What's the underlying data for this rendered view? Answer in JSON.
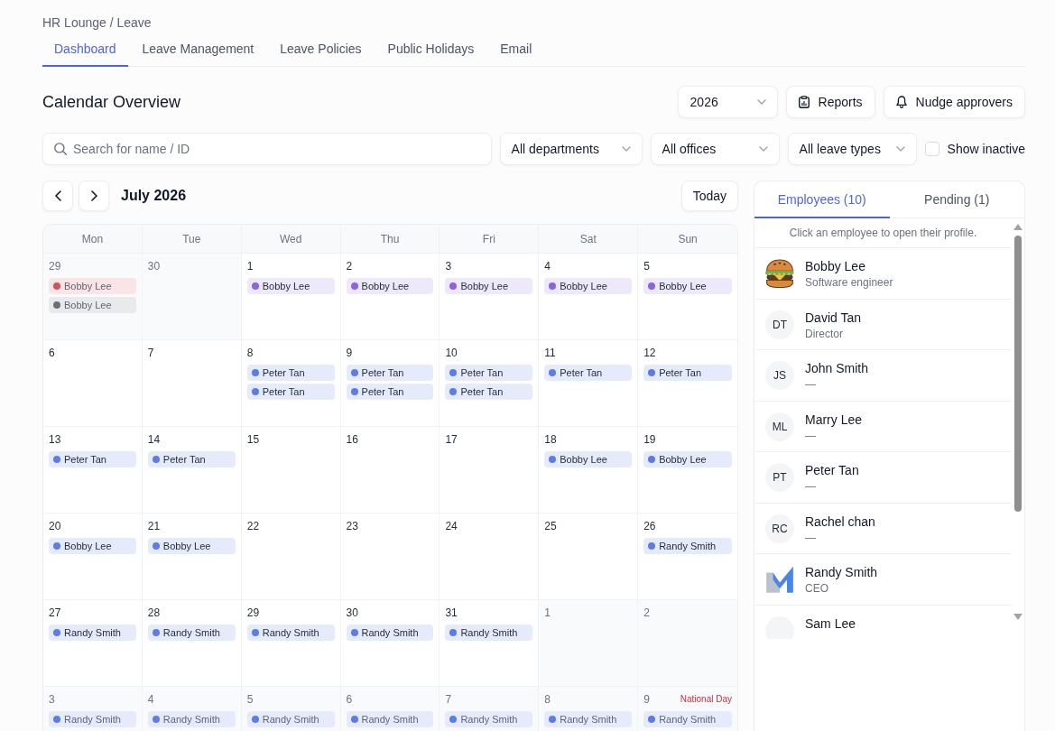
{
  "breadcrumb": "HR Lounge / Leave",
  "tabs": [
    {
      "label": "Dashboard",
      "selected": true
    },
    {
      "label": "Leave Management",
      "selected": false
    },
    {
      "label": "Leave Policies",
      "selected": false
    },
    {
      "label": "Public Holidays",
      "selected": false
    },
    {
      "label": "Email",
      "selected": false
    }
  ],
  "header": {
    "title": "Calendar Overview",
    "year_select": "2026",
    "reports_button": "Reports",
    "nudge_button": "Nudge approvers"
  },
  "filters": {
    "search": {
      "placeholder": "Search for name / ID"
    },
    "selects": [
      "All departments",
      "All offices",
      "All leave types"
    ],
    "show_inactive": {
      "label": "Show inactive",
      "checked": false
    }
  },
  "calendar": {
    "month": "July 2026",
    "today_button": "Today",
    "weekdays": [
      "Mon",
      "Tue",
      "Wed",
      "Thu",
      "Fri",
      "Sat",
      "Sun"
    ],
    "weeks": [
      [
        {
          "date": "29",
          "outside": true,
          "events": [
            {
              "name": "Bobby Lee",
              "color": "#d4525a"
            },
            {
              "name": "Bobby Lee",
              "color": "#6b7078"
            }
          ]
        },
        {
          "date": "30",
          "outside": true
        },
        {
          "date": "1",
          "outside": false,
          "events": [
            {
              "name": "Bobby Lee",
              "color": "#8b63e6"
            }
          ]
        },
        {
          "date": "2",
          "outside": false,
          "events": [
            {
              "name": "Bobby Lee",
              "color": "#8b63e6"
            }
          ]
        },
        {
          "date": "3",
          "outside": false,
          "events": [
            {
              "name": "Bobby Lee",
              "color": "#8b63e6"
            }
          ]
        },
        {
          "date": "4",
          "outside": false,
          "events": [
            {
              "name": "Bobby Lee",
              "color": "#8b63e6"
            }
          ]
        },
        {
          "date": "5",
          "outside": false,
          "events": [
            {
              "name": "Bobby Lee",
              "color": "#8b63e6"
            }
          ]
        }
      ],
      [
        {
          "date": "6",
          "outside": false
        },
        {
          "date": "7",
          "outside": false
        },
        {
          "date": "8",
          "outside": false,
          "events": [
            {
              "name": "Peter Tan",
              "color": "#5b7ced"
            },
            {
              "name": "Peter Tan",
              "color": "#5b7ced"
            }
          ]
        },
        {
          "date": "9",
          "outside": false,
          "events": [
            {
              "name": "Peter Tan",
              "color": "#5b7ced"
            },
            {
              "name": "Peter Tan",
              "color": "#5b7ced"
            }
          ]
        },
        {
          "date": "10",
          "outside": false,
          "events": [
            {
              "name": "Peter Tan",
              "color": "#5b7ced"
            },
            {
              "name": "Peter Tan",
              "color": "#5b7ced"
            }
          ]
        },
        {
          "date": "11",
          "outside": false,
          "events": [
            {
              "name": "Peter Tan",
              "color": "#5b7ced"
            }
          ]
        },
        {
          "date": "12",
          "outside": false,
          "events": [
            {
              "name": "Peter Tan",
              "color": "#5b7ced"
            }
          ]
        }
      ],
      [
        {
          "date": "13",
          "outside": false,
          "events": [
            {
              "name": "Peter Tan",
              "color": "#5b7ced"
            }
          ]
        },
        {
          "date": "14",
          "outside": false,
          "events": [
            {
              "name": "Peter Tan",
              "color": "#5b7ced"
            }
          ]
        },
        {
          "date": "15",
          "outside": false
        },
        {
          "date": "16",
          "outside": false
        },
        {
          "date": "17",
          "outside": false
        },
        {
          "date": "18",
          "outside": false,
          "events": [
            {
              "name": "Bobby Lee",
              "color": "#5b7ced"
            }
          ]
        },
        {
          "date": "19",
          "outside": false,
          "events": [
            {
              "name": "Bobby Lee",
              "color": "#5b7ced"
            }
          ]
        }
      ],
      [
        {
          "date": "20",
          "outside": false,
          "events": [
            {
              "name": "Bobby Lee",
              "color": "#5b7ced"
            }
          ]
        },
        {
          "date": "21",
          "outside": false,
          "events": [
            {
              "name": "Bobby Lee",
              "color": "#5b7ced"
            }
          ]
        },
        {
          "date": "22",
          "outside": false
        },
        {
          "date": "23",
          "outside": false
        },
        {
          "date": "24",
          "outside": false
        },
        {
          "date": "25",
          "outside": false
        },
        {
          "date": "26",
          "outside": false,
          "events": [
            {
              "name": "Randy Smith",
              "color": "#5b7ced"
            }
          ]
        }
      ],
      [
        {
          "date": "27",
          "outside": false,
          "events": [
            {
              "name": "Randy Smith",
              "color": "#5b7ced"
            }
          ]
        },
        {
          "date": "28",
          "outside": false,
          "events": [
            {
              "name": "Randy Smith",
              "color": "#5b7ced"
            }
          ]
        },
        {
          "date": "29",
          "outside": false,
          "events": [
            {
              "name": "Randy Smith",
              "color": "#5b7ced"
            }
          ]
        },
        {
          "date": "30",
          "outside": false,
          "events": [
            {
              "name": "Randy Smith",
              "color": "#5b7ced"
            }
          ]
        },
        {
          "date": "31",
          "outside": false,
          "events": [
            {
              "name": "Randy Smith",
              "color": "#5b7ced"
            }
          ]
        },
        {
          "date": "1",
          "outside": true
        },
        {
          "date": "2",
          "outside": true
        }
      ],
      [
        {
          "date": "3",
          "outside": true,
          "events": [
            {
              "name": "Randy Smith",
              "color": "#5b7ced"
            }
          ]
        },
        {
          "date": "4",
          "outside": true,
          "events": [
            {
              "name": "Randy Smith",
              "color": "#5b7ced"
            }
          ]
        },
        {
          "date": "5",
          "outside": true,
          "events": [
            {
              "name": "Randy Smith",
              "color": "#5b7ced"
            }
          ]
        },
        {
          "date": "6",
          "outside": true,
          "events": [
            {
              "name": "Randy Smith",
              "color": "#5b7ced"
            }
          ]
        },
        {
          "date": "7",
          "outside": true,
          "events": [
            {
              "name": "Randy Smith",
              "color": "#5b7ced"
            }
          ]
        },
        {
          "date": "8",
          "outside": true,
          "events": [
            {
              "name": "Randy Smith",
              "color": "#5b7ced"
            }
          ]
        },
        {
          "date": "9",
          "outside": true,
          "holiday": "National Day",
          "events": [
            {
              "name": "Randy Smith",
              "color": "#5b7ced"
            }
          ]
        }
      ]
    ]
  },
  "employees_panel": {
    "tabs": [
      {
        "label": "Employees (10)",
        "selected": true
      },
      {
        "label": "Pending (1)",
        "selected": false
      }
    ],
    "hint": "Click an employee to open their profile.",
    "employees": [
      {
        "name": "Bobby Lee",
        "role": "Software engineer",
        "avatar": {
          "kind": "illustration"
        }
      },
      {
        "name": "David Tan",
        "role": "Director",
        "avatar": {
          "kind": "initials",
          "text": "DT"
        }
      },
      {
        "name": "John Smith",
        "role": "—",
        "avatar": {
          "kind": "initials",
          "text": "JS"
        }
      },
      {
        "name": "Marry Lee",
        "role": "—",
        "avatar": {
          "kind": "initials",
          "text": "ML"
        }
      },
      {
        "name": "Peter Tan",
        "role": "—",
        "avatar": {
          "kind": "initials",
          "text": "PT"
        }
      },
      {
        "name": "Rachel chan",
        "role": "—",
        "avatar": {
          "kind": "initials",
          "text": "RC"
        }
      },
      {
        "name": "Randy Smith",
        "role": "CEO",
        "avatar": {
          "kind": "logo"
        }
      },
      {
        "name": "Sam Lee",
        "avatar": {
          "kind": "blank"
        }
      }
    ]
  }
}
